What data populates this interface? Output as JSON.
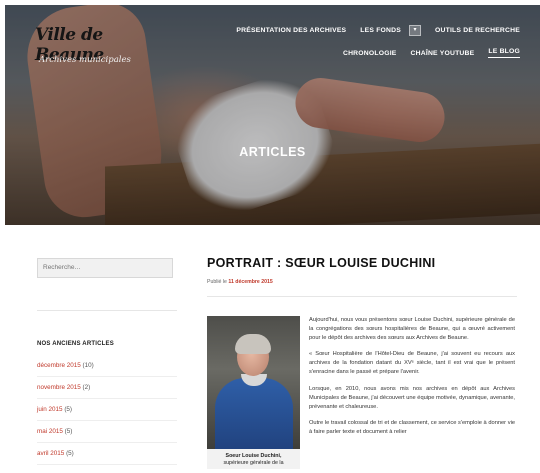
{
  "header": {
    "logo_script": "Ville de Beaune",
    "logo_subtitle": "Archives municipales",
    "nav_row1": [
      "PRÉSENTATION DES ARCHIVES",
      "LES FONDS",
      "OUTILS DE RECHERCHE"
    ],
    "nav_row2": [
      "CHRONOLOGIE",
      "CHAÎNE YOUTUBE",
      "LE BLOG"
    ],
    "active_item": "LE BLOG",
    "dropdown_icon": "chevron-down-icon",
    "hero_title": "ARTICLES"
  },
  "sidebar": {
    "search_placeholder": "Recherche…",
    "archives_title": "NOS ANCIENS ARTICLES",
    "archives": [
      {
        "label": "décembre 2015",
        "count": "(10)"
      },
      {
        "label": "novembre 2015",
        "count": "(2)"
      },
      {
        "label": "juin 2015",
        "count": "(5)"
      },
      {
        "label": "mai 2015",
        "count": "(5)"
      },
      {
        "label": "avril 2015",
        "count": "(5)"
      }
    ]
  },
  "post": {
    "title": "PORTRAIT : SŒUR LOUISE DUCHINI",
    "meta_prefix": "Publié le",
    "date": "11 décembre 2015",
    "caption_name": "Soeur Louise Duchini,",
    "caption_role": "supérieure générale de la",
    "paragraphs": [
      "Aujourd'hui, nous vous présentons sœur Louise Duchini, supérieure générale de la congrégations des sœurs hospitalières de Beaune, qui a œuvré activement pour le dépôt des archives des sœurs aux Archives de Beaune.",
      "« Sœur Hospitalière de l'Hôtel-Dieu de Beaune, j'ai souvent eu recours aux archives de la fondation datant du XVᵉ siècle, tant il est vrai que le présent s'enracine dans le passé et prépare l'avenir.",
      "Lorsque, en 2010, nous avons mis nos archives en dépôt aux Archives Municipales de Beaune, j'ai découvert une équipe motivée, dynamique, avenante, prévenante et chaleureuse.",
      "Outre le travail colossal de tri et de classement, ce service s'emploie à donner vie à faire parler texte et document à relier"
    ]
  },
  "colors": {
    "accent": "#c0392b",
    "sidebar_bg": "#f1f1f1"
  }
}
